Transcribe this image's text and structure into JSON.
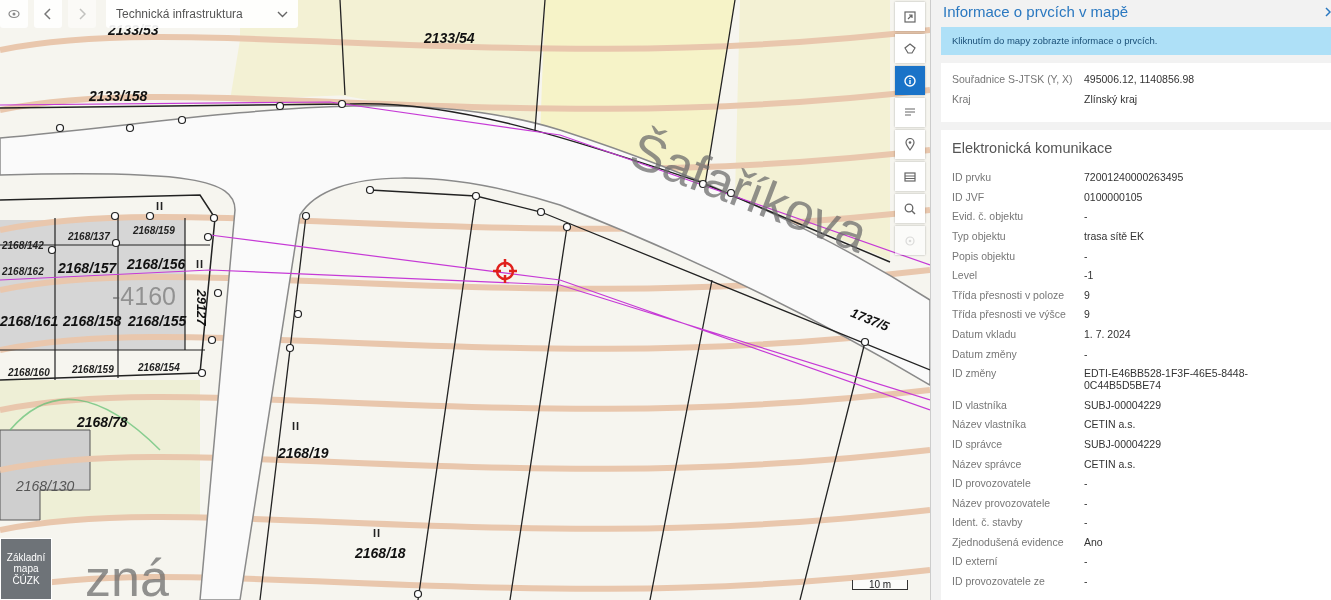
{
  "map_toolbar": {
    "buttons": [
      {
        "kind": "visibility",
        "disabled": false
      },
      {
        "kind": "back",
        "disabled": false
      },
      {
        "kind": "forward",
        "disabled": true
      }
    ],
    "layer_select": {
      "value": "Technická infrastruktura"
    }
  },
  "map": {
    "labels": [
      {
        "text": "2133/53",
        "kind": "parcel"
      },
      {
        "text": "2133/54",
        "kind": "parcel"
      },
      {
        "text": "2133/158",
        "kind": "parcel"
      },
      {
        "text": "2168/142",
        "kind": "small"
      },
      {
        "text": "2168/137",
        "kind": "small"
      },
      {
        "text": "II",
        "kind": "mark"
      },
      {
        "text": "2168/159",
        "kind": "small"
      },
      {
        "text": "2168/162",
        "kind": "small"
      },
      {
        "text": "2168/157",
        "kind": "parcel"
      },
      {
        "text": "2168/156",
        "kind": "parcel"
      },
      {
        "text": "II",
        "kind": "mark"
      },
      {
        "text": "29127",
        "kind": "vertical"
      },
      {
        "text": "-4160",
        "kind": "elevation"
      },
      {
        "text": "2168/161",
        "kind": "parcel"
      },
      {
        "text": "2168/158",
        "kind": "parcel"
      },
      {
        "text": "2168/155",
        "kind": "parcel"
      },
      {
        "text": "2168/160",
        "kind": "small"
      },
      {
        "text": "2168/159",
        "kind": "small"
      },
      {
        "text": "2168/154",
        "kind": "small"
      },
      {
        "text": "2168/78",
        "kind": "parcel"
      },
      {
        "text": "II",
        "kind": "mark"
      },
      {
        "text": "2168/19",
        "kind": "parcel"
      },
      {
        "text": "2168/130",
        "kind": "building"
      },
      {
        "text": "II",
        "kind": "mark"
      },
      {
        "text": "2168/18",
        "kind": "parcel"
      },
      {
        "text": "Šafaříkova",
        "kind": "street"
      },
      {
        "text": "1737/5",
        "kind": "road"
      },
      {
        "text": "zná",
        "kind": "street"
      }
    ],
    "scale": "10 m",
    "basemap": "Základní mapa ČÚZK",
    "tools": [
      {
        "kind": "expand",
        "selected": false,
        "disabled": false
      },
      {
        "kind": "lasso",
        "selected": false,
        "disabled": false
      },
      {
        "kind": "info",
        "selected": true,
        "disabled": false
      },
      {
        "kind": "list",
        "selected": false,
        "disabled": false
      },
      {
        "kind": "pin",
        "selected": false,
        "disabled": false
      },
      {
        "kind": "layers",
        "selected": false,
        "disabled": false
      },
      {
        "kind": "search",
        "selected": false,
        "disabled": false
      },
      {
        "kind": "target",
        "selected": false,
        "disabled": true
      }
    ]
  },
  "panel": {
    "title": "Informace o prvcích v mapě",
    "notice": "Kliknutím do mapy zobrazte informace o prvcích.",
    "location": [
      {
        "label": "Souřadnice S-JTSK (Y, X)",
        "value": "495006.12, 1140856.98"
      },
      {
        "label": "Kraj",
        "value": "Zlínský kraj"
      }
    ],
    "feature": {
      "title": "Elektronická komunikace",
      "rows": [
        {
          "label": "ID prvku",
          "value": "72001240000263495"
        },
        {
          "label": "ID JVF",
          "value": "0100000105"
        },
        {
          "label": "Evid. č. objektu",
          "value": "-"
        },
        {
          "label": "Typ objektu",
          "value": "trasa sítě EK"
        },
        {
          "label": "Popis objektu",
          "value": "-"
        },
        {
          "label": "Level",
          "value": "-1"
        },
        {
          "label": "Třída přesnosti v poloze",
          "value": "9"
        },
        {
          "label": "Třída přesnosti ve výšce",
          "value": "9"
        },
        {
          "label": "Datum vkladu",
          "value": "1. 7. 2024"
        },
        {
          "label": "Datum změny",
          "value": "-"
        },
        {
          "label": "ID změny",
          "value": "EDTI-E46BB528-1F3F-46E5-8448-0C44B5D5BE74"
        },
        {
          "label": "ID vlastníka",
          "value": "SUBJ-00004229"
        },
        {
          "label": "Název vlastníka",
          "value": "CETIN a.s."
        },
        {
          "label": "ID správce",
          "value": "SUBJ-00004229"
        },
        {
          "label": "Název správce",
          "value": "CETIN a.s."
        },
        {
          "label": "ID provozovatele",
          "value": "-"
        },
        {
          "label": "Název provozovatele",
          "value": "-"
        },
        {
          "label": "Ident. č. stavby",
          "value": "-"
        },
        {
          "label": "Zjednodušená evidence",
          "value": "Ano"
        },
        {
          "label": "ID externí",
          "value": "-"
        },
        {
          "label": "ID provozovatele ze",
          "value": "-"
        }
      ]
    }
  }
}
